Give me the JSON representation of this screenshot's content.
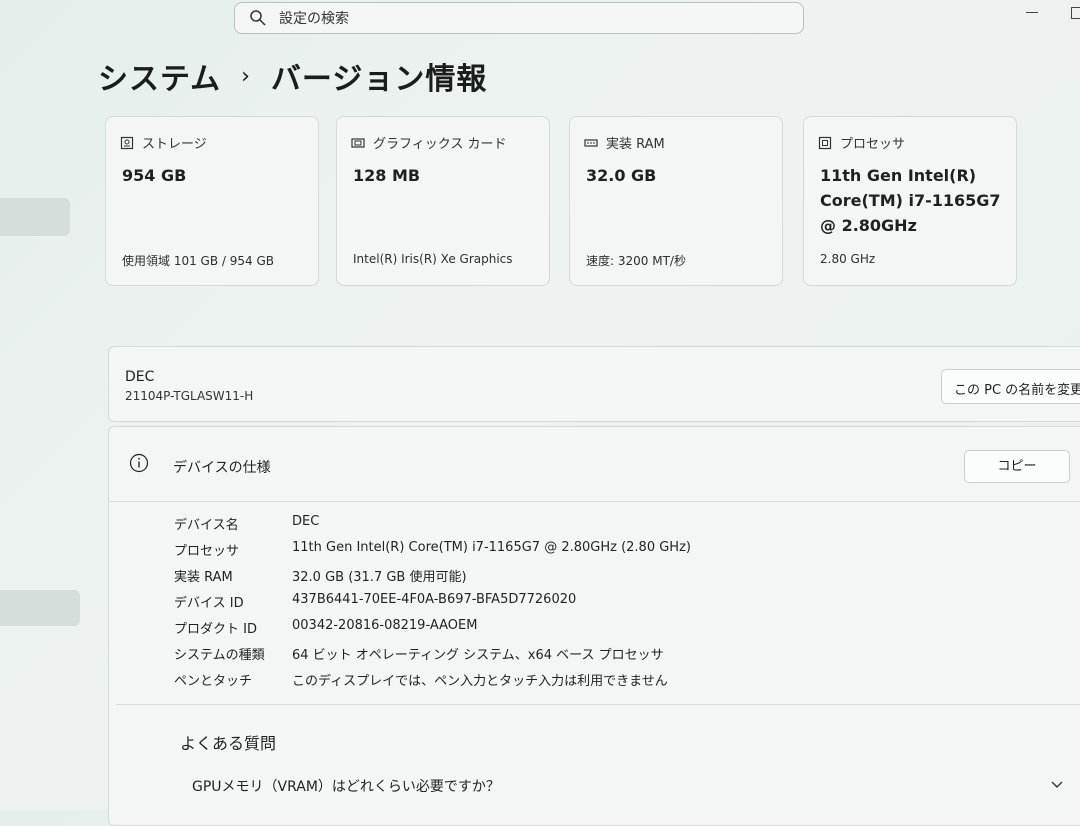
{
  "search": {
    "placeholder": "設定の検索"
  },
  "breadcrumb": {
    "parent": "システム",
    "separator": "›",
    "current": "バージョン情報"
  },
  "cards": [
    {
      "label": "ストレージ",
      "value": "954 GB",
      "detail": "使用領域 101 GB / 954 GB",
      "icon": "storage-icon"
    },
    {
      "label": "グラフィックス カード",
      "value": "128 MB",
      "detail": "Intel(R) Iris(R) Xe Graphics",
      "icon": "graphics-card-icon"
    },
    {
      "label": "実装 RAM",
      "value": "32.0 GB",
      "detail": "速度: 3200 MT/秒",
      "icon": "ram-icon"
    },
    {
      "label": "プロセッサ",
      "value": "11th Gen Intel(R) Core(TM) i7-1165G7 @ 2.80GHz",
      "detail": "2.80 GHz",
      "icon": "processor-icon"
    }
  ],
  "device": {
    "name": "DEC",
    "model": "21104P-TGLASW11-H",
    "rename_label": "この PC の名前を変更"
  },
  "specs": {
    "title": "デバイスの仕様",
    "copy_label": "コピー",
    "rows": [
      {
        "key": "デバイス名",
        "value": "DEC"
      },
      {
        "key": "プロセッサ",
        "value": "11th Gen Intel(R) Core(TM) i7-1165G7 @ 2.80GHz (2.80 GHz)"
      },
      {
        "key": "実装 RAM",
        "value": "32.0 GB (31.7 GB 使用可能)"
      },
      {
        "key": "デバイス ID",
        "value": "437B6441-70EE-4F0A-B697-BFA5D7726020"
      },
      {
        "key": "プロダクト ID",
        "value": "00342-20816-08219-AAOEM"
      },
      {
        "key": "システムの種類",
        "value": "64 ビット オペレーティング システム、x64 ベース プロセッサ"
      },
      {
        "key": "ペンとタッチ",
        "value": "このディスプレイでは、ペン入力とタッチ入力は利用できません"
      }
    ]
  },
  "faq": {
    "title": "よくある質問",
    "question": "GPUメモリ（VRAM）はどれくらい必要ですか？"
  }
}
